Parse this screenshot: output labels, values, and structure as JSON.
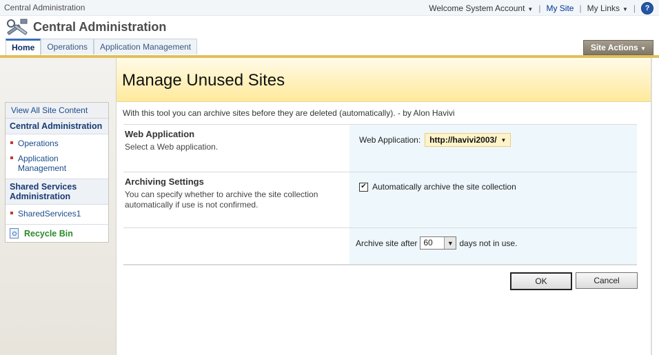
{
  "topbar": {
    "brand": "Central Administration",
    "welcome": "Welcome System Account",
    "my_site": "My Site",
    "my_links": "My Links",
    "help_glyph": "?"
  },
  "header": {
    "site_title": "Central Administration",
    "icon": "tools-icon"
  },
  "tabs": [
    {
      "label": "Home",
      "active": true
    },
    {
      "label": "Operations",
      "active": false
    },
    {
      "label": "Application Management",
      "active": false
    }
  ],
  "site_actions": "Site Actions",
  "leftnav": {
    "view_all": "View All Site Content",
    "group1_title": "Central Administration",
    "group1_items": [
      "Operations",
      "Application Management"
    ],
    "group2_title": "Shared Services Administration",
    "group2_items": [
      "SharedServices1"
    ],
    "recycle_bin": "Recycle Bin"
  },
  "page": {
    "title": "Manage Unused Sites",
    "description": "With this tool you can archive sites before they are deleted (automatically). - by Alon Havivi"
  },
  "sections": {
    "webapp": {
      "title": "Web Application",
      "desc": "Select a Web application.",
      "field_label": "Web Application:",
      "value": "http://havivi2003/"
    },
    "archiving": {
      "title": "Archiving Settings",
      "desc": "You can specify whether to archive the site collection automatically if use is not confirmed.",
      "checkbox_label": "Automatically archive the site collection",
      "checked": true
    },
    "archive_after": {
      "prefix": "Archive site after",
      "days": "60",
      "suffix": "days not in use."
    }
  },
  "buttons": {
    "ok": "OK",
    "cancel": "Cancel"
  },
  "colors": {
    "title_bar": "#ffe99b",
    "accent_tab": "#3b6fb6",
    "recycle_green": "#2a8a2a"
  }
}
